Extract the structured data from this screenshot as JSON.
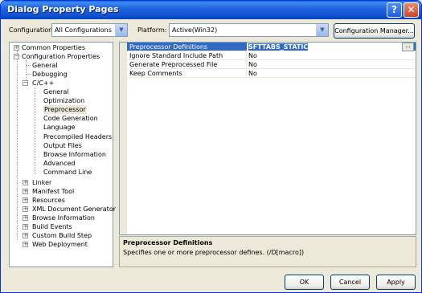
{
  "window": {
    "title": "Dialog Property Pages",
    "help": "?",
    "close": "✕"
  },
  "toolbar": {
    "configuration_label": "Configuration:",
    "configuration_value": "All Configurations",
    "platform_label": "Platform:",
    "platform_value": "Active(Win32)",
    "config_manager": "Configuration Manager..."
  },
  "tree": {
    "common": "Common Properties",
    "config_props": "Configuration Properties",
    "general": "General",
    "debugging": "Debugging",
    "cpp": "C/C++",
    "cpp_children": [
      "General",
      "Optimization",
      "Preprocessor",
      "Code Generation",
      "Language",
      "Precompiled Headers",
      "Output Files",
      "Browse Information",
      "Advanced",
      "Command Line"
    ],
    "bottom": [
      "Linker",
      "Manifest Tool",
      "Resources",
      "XML Document Generator",
      "Browse Information",
      "Build Events",
      "Custom Build Step",
      "Web Deployment"
    ]
  },
  "grid": {
    "rows": [
      {
        "name": "Preprocessor Definitions",
        "value": "SFTTABS_STATIC"
      },
      {
        "name": "Ignore Standard Include Path",
        "value": "No"
      },
      {
        "name": "Generate Preprocessed File",
        "value": "No"
      },
      {
        "name": "Keep Comments",
        "value": "No"
      }
    ],
    "ellipsis": "..."
  },
  "description": {
    "title": "Preprocessor Definitions",
    "text": "Specifies one or more preprocessor defines.     (/D[macro])"
  },
  "buttons": {
    "ok": "OK",
    "cancel": "Cancel",
    "apply": "Apply"
  }
}
